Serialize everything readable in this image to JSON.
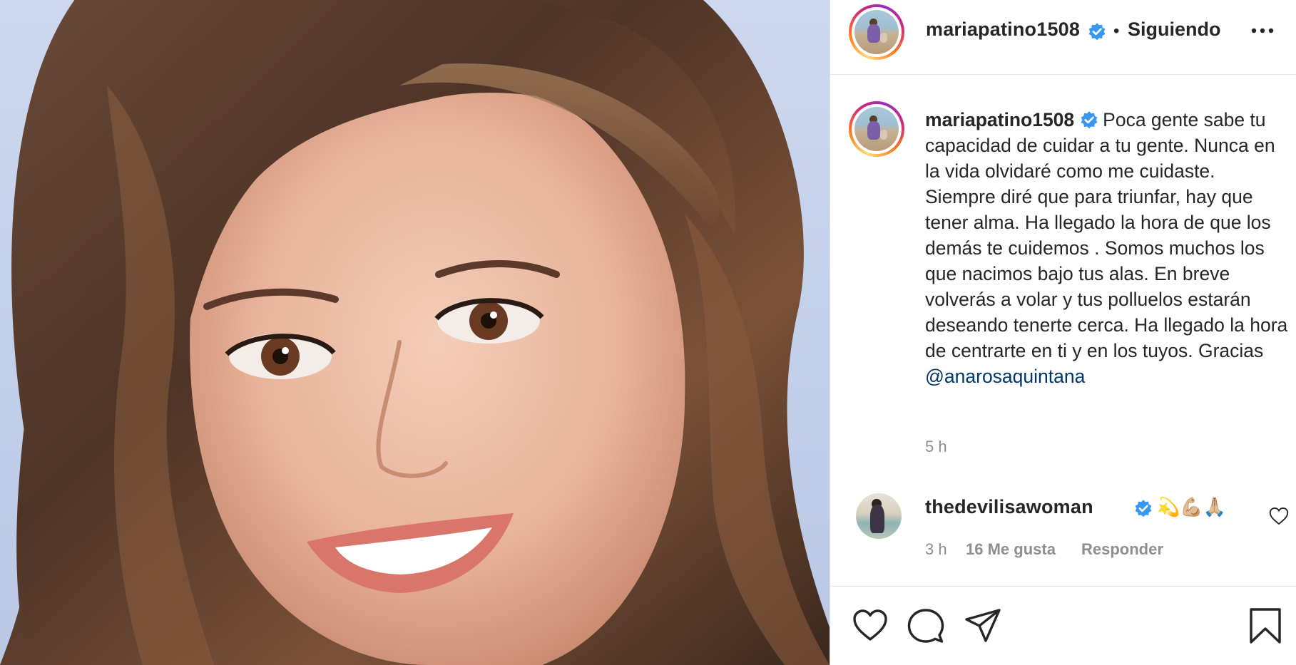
{
  "post": {
    "author": "mariapatino1508",
    "follow_separator": "•",
    "follow_status": "Siguiendo",
    "caption_text": "Poca gente sabe tu capacidad de cuidar a tu gente. Nunca en la vida olvidaré como me cuidaste. Siempre diré que para triunfar, hay que tener alma. Ha llegado la hora de que los demás te cuidemos . Somos muchos los que nacimos bajo tus alas. En breve volverás a volar y tus polluelos estarán deseando tenerte cerca. Ha llegado la hora de centrarte en ti y en los tuyos. Gracias",
    "caption_mention": "@anarosaquintana",
    "time_ago": "5 h"
  },
  "comment": {
    "author": "thedevilisawoman",
    "text": "💫💪🏼🙏🏼",
    "time_ago": "3 h",
    "likes": "16 Me gusta",
    "reply": "Responder"
  },
  "icons": {
    "verified": "verified-badge-icon",
    "more": "more-options-icon",
    "like": "heart-icon",
    "comment": "comment-icon",
    "share": "send-icon",
    "save": "bookmark-icon"
  },
  "colors": {
    "verified_blue": "#3897f0",
    "mention_blue": "#00376b",
    "muted": "#8e8e8e",
    "text": "#262626"
  }
}
